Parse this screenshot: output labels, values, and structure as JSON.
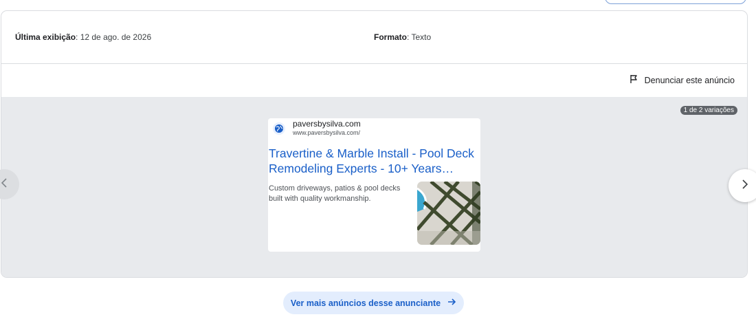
{
  "info": {
    "last_seen_label": "Última exibição",
    "last_seen_value": ": 12 de ago. de 2026",
    "format_label": "Formato",
    "format_value": ": Texto"
  },
  "report": {
    "label": "Denunciar este anúncio",
    "icon": "flag-icon"
  },
  "preview": {
    "variations_badge": "1 de 2 variações",
    "ad": {
      "domain": "paversbysilva.com",
      "url": "www.paversbysilva.com/",
      "title": "Travertine & Marble Install - Pool Deck Remodeling Experts - 10+ Years…",
      "description": "Custom driveways, patios & pool decks built with quality workmanship."
    }
  },
  "navigation": {
    "prev_icon": "chevron-left-icon",
    "next_icon": "chevron-right-icon"
  },
  "more_ads": {
    "label": "Ver mais anúncios desse anunciante",
    "icon": "arrow-right-icon"
  },
  "colors": {
    "link_blue": "#1a5fc8",
    "preview_bg": "#e8eaed",
    "badge_bg": "#5f6368",
    "more_btn_bg": "#e3edfd"
  }
}
